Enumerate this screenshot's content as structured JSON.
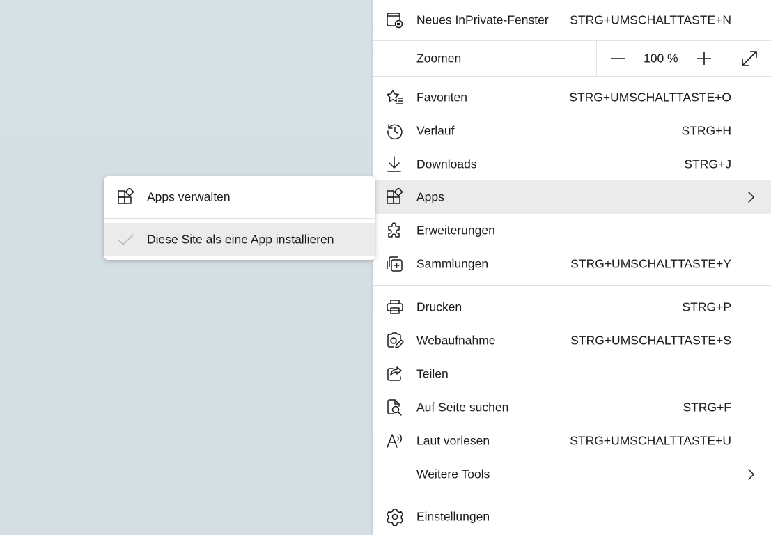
{
  "colors": {
    "background": "#d4e0e5",
    "menu_background": "#ffffff",
    "highlight": "#ebebeb",
    "text": "#1b1b1b",
    "divider": "#e1e1e1"
  },
  "menu": {
    "inprivate": {
      "label": "Neues InPrivate-Fenster",
      "shortcut": "STRG+UMSCHALTTASTE+N",
      "icon": "inprivate-window-icon"
    },
    "zoom": {
      "label": "Zoomen",
      "value": "100 %",
      "decrease_icon": "minus-icon",
      "increase_icon": "plus-icon",
      "fullscreen_icon": "fullscreen-icon"
    },
    "favorites": {
      "label": "Favoriten",
      "shortcut": "STRG+UMSCHALTTASTE+O",
      "icon": "favorites-icon"
    },
    "history": {
      "label": "Verlauf",
      "shortcut": "STRG+H",
      "icon": "history-icon"
    },
    "downloads": {
      "label": "Downloads",
      "shortcut": "STRG+J",
      "icon": "download-icon"
    },
    "apps": {
      "label": "Apps",
      "icon": "apps-icon"
    },
    "extensions": {
      "label": "Erweiterungen",
      "icon": "puzzle-icon"
    },
    "collections": {
      "label": "Sammlungen",
      "shortcut": "STRG+UMSCHALTTASTE+Y",
      "icon": "collections-icon"
    },
    "print": {
      "label": "Drucken",
      "shortcut": "STRG+P",
      "icon": "printer-icon"
    },
    "webcapture": {
      "label": "Webaufnahme",
      "shortcut": "STRG+UMSCHALTTASTE+S",
      "icon": "web-capture-icon"
    },
    "share": {
      "label": "Teilen",
      "icon": "share-icon"
    },
    "find": {
      "label": "Auf Seite suchen",
      "shortcut": "STRG+F",
      "icon": "find-on-page-icon"
    },
    "read_aloud": {
      "label": "Laut vorlesen",
      "shortcut": "STRG+UMSCHALTTASTE+U",
      "icon": "read-aloud-icon"
    },
    "more_tools": {
      "label": "Weitere Tools"
    },
    "settings": {
      "label": "Einstellungen",
      "icon": "gear-icon"
    }
  },
  "submenu": {
    "manage_apps": {
      "label": "Apps verwalten",
      "icon": "apps-icon"
    },
    "install_site": {
      "label": "Diese Site als eine App installieren",
      "icon": "checkmark-icon"
    }
  }
}
